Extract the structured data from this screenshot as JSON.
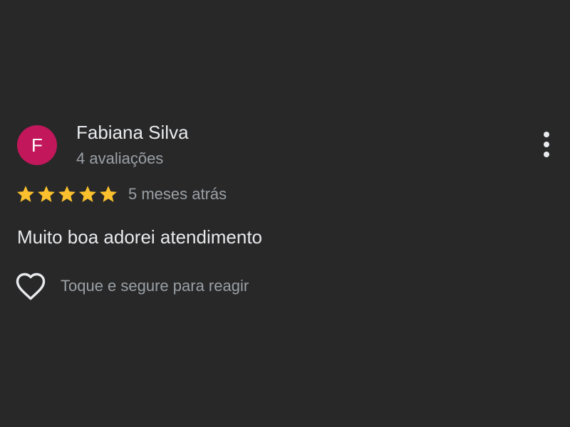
{
  "review": {
    "avatar_initial": "F",
    "avatar_color": "#c2185b",
    "reviewer_name": "Fabiana Silva",
    "review_count": "4 avaliações",
    "rating": 5,
    "rating_max": 5,
    "star_color": "#fbc02d",
    "time_ago": "5 meses atrás",
    "text": "Muito boa adorei atendimento",
    "react_label": "Toque e segure para reagir",
    "menu_icon": "more-vert-icon",
    "react_icon": "heart-outline-icon",
    "star_icon": "star-icon"
  }
}
